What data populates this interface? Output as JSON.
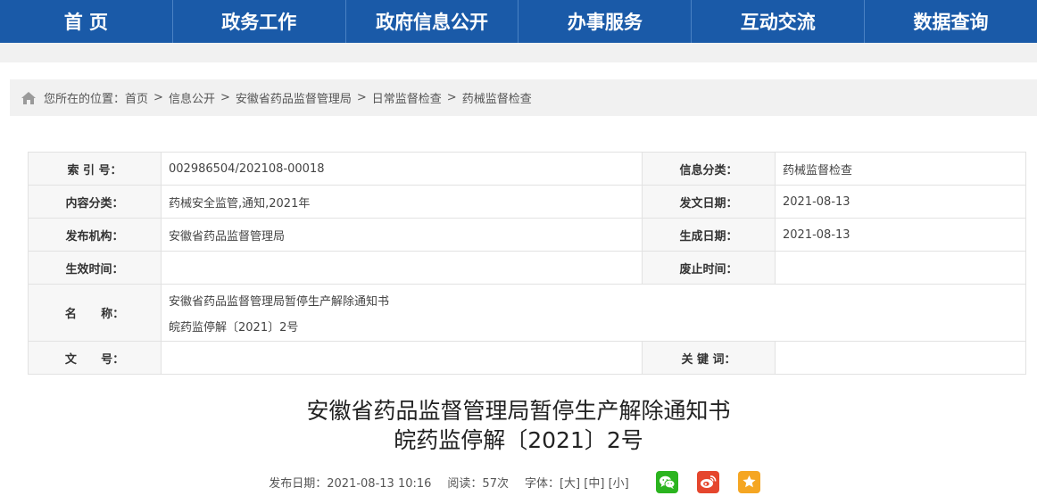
{
  "nav": {
    "items": [
      "首 页",
      "政务工作",
      "政府信息公开",
      "办事服务",
      "互动交流",
      "数据查询"
    ]
  },
  "breadcrumb": {
    "prefix": "您所在的位置：",
    "items": [
      "首页",
      "信息公开",
      "安徽省药品监督管理局",
      "日常监督检查",
      "药械监督检查"
    ],
    "separator": ">"
  },
  "info": {
    "index_label": "索 引 号：",
    "index_value": "002986504/202108-00018",
    "category_label": "信息分类：",
    "category_value": "药械监督检查",
    "content_label": "内容分类：",
    "content_value": "药械安全监管,通知,2021年",
    "issue_date_label": "发文日期：",
    "issue_date_value": "2021-08-13",
    "publisher_label": "发布机构：",
    "publisher_value": "安徽省药品监督管理局",
    "gen_date_label": "生成日期：",
    "gen_date_value": "2021-08-13",
    "effective_label": "生效时间：",
    "effective_value": "",
    "expire_label": "废止时间：",
    "expire_value": "",
    "name_label": "名      称：",
    "name_value_1": "安徽省药品监督管理局暂停生产解除通知书",
    "name_value_2": "皖药监停解〔2021〕2号",
    "docno_label": "文      号：",
    "docno_value": "",
    "keywords_label": "关 键 词：",
    "keywords_value": ""
  },
  "title": {
    "line1": "安徽省药品监督管理局暂停生产解除通知书",
    "line2": "皖药监停解〔2021〕2号"
  },
  "meta": {
    "publish": "发布日期：2021-08-13 10:16",
    "views": "阅读：57次",
    "font_label": "字体：",
    "font_large": "[大]",
    "font_medium": "[中]",
    "font_small": "[小]"
  },
  "colors": {
    "nav_bg": "#1a5aa8",
    "wechat": "#2bb41f",
    "weibo": "#e5462d",
    "favorite": "#f5a623"
  },
  "icons": [
    "home-icon",
    "wechat-icon",
    "weibo-icon",
    "star-icon"
  ]
}
